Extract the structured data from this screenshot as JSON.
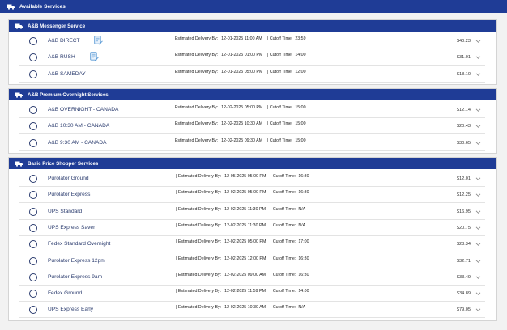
{
  "page": {
    "title": "Available Services",
    "title_icon": "truck-icon"
  },
  "groups": [
    {
      "title": "A&B Messenger Service",
      "icon": "truck-icon",
      "services": [
        {
          "name": "A&B DIRECT",
          "has_note": true,
          "note_icon": "note-edit-icon",
          "delivery_label": "| Estimated Delivery By:",
          "delivery": "12-01-2025 11:00 AM",
          "cutoff_label": "| Cutoff Time:",
          "cutoff": "23:59",
          "price": "$40.23"
        },
        {
          "name": "A&B RUSH",
          "has_note": true,
          "note_icon": "note-edit-icon",
          "delivery_label": "| Estimated Delivery By:",
          "delivery": "12-01-2025 01:00 PM",
          "cutoff_label": "| Cutoff Time:",
          "cutoff": "14:00",
          "price": "$31.01"
        },
        {
          "name": "A&B SAMEDAY",
          "has_note": false,
          "delivery_label": "| Estimated Delivery By:",
          "delivery": "12-01-2025 05:00 PM",
          "cutoff_label": "| Cutoff Time:",
          "cutoff": "12:00",
          "price": "$18.10"
        }
      ]
    },
    {
      "title": "A&B Premium Overnight Services",
      "icon": "truck-icon",
      "services": [
        {
          "name": "A&B OVERNIGHT - CANADA",
          "has_note": false,
          "delivery_label": "| Estimated Delivery By:",
          "delivery": "12-02-2025 05:00 PM",
          "cutoff_label": "| Cutoff Time:",
          "cutoff": "15:00",
          "price": "$12.14"
        },
        {
          "name": "A&B 10:30 AM - CANADA",
          "has_note": false,
          "delivery_label": "| Estimated Delivery By:",
          "delivery": "12-02-2025 10:30 AM",
          "cutoff_label": "| Cutoff Time:",
          "cutoff": "15:00",
          "price": "$20.43"
        },
        {
          "name": "A&B 9:30 AM - CANADA",
          "has_note": false,
          "delivery_label": "| Estimated Delivery By:",
          "delivery": "12-02-2025 09:30 AM",
          "cutoff_label": "| Cutoff Time:",
          "cutoff": "15:00",
          "price": "$30.65"
        }
      ]
    },
    {
      "title": "Basic Price Shopper Services",
      "icon": "truck-icon",
      "services": [
        {
          "name": "Purolator Ground",
          "has_note": false,
          "delivery_label": "| Estimated Delivery By:",
          "delivery": "12-05-2025 05:00 PM",
          "cutoff_label": "| Cutoff Time:",
          "cutoff": "16:30",
          "price": "$12.01"
        },
        {
          "name": "Purolator Express",
          "has_note": false,
          "delivery_label": "| Estimated Delivery By:",
          "delivery": "12-02-2025 05:00 PM",
          "cutoff_label": "| Cutoff Time:",
          "cutoff": "16:30",
          "price": "$12.25"
        },
        {
          "name": "UPS Standard",
          "has_note": false,
          "delivery_label": "| Estimated Delivery By:",
          "delivery": "12-02-2025 11:30 PM",
          "cutoff_label": "| Cutoff Time:",
          "cutoff": "N/A",
          "price": "$16.95"
        },
        {
          "name": "UPS Express Saver",
          "has_note": false,
          "delivery_label": "| Estimated Delivery By:",
          "delivery": "12-02-2025 11:30 PM",
          "cutoff_label": "| Cutoff Time:",
          "cutoff": "N/A",
          "price": "$20.75"
        },
        {
          "name": "Fedex Standard Overnight",
          "has_note": false,
          "delivery_label": "| Estimated Delivery By:",
          "delivery": "12-02-2025 05:00 PM",
          "cutoff_label": "| Cutoff Time:",
          "cutoff": "17:00",
          "price": "$28.34"
        },
        {
          "name": "Purolator Express 12pm",
          "has_note": false,
          "delivery_label": "| Estimated Delivery By:",
          "delivery": "12-02-2025 12:00 PM",
          "cutoff_label": "| Cutoff Time:",
          "cutoff": "16:30",
          "price": "$32.71"
        },
        {
          "name": "Purolator Express 9am",
          "has_note": false,
          "delivery_label": "| Estimated Delivery By:",
          "delivery": "12-02-2025 09:00 AM",
          "cutoff_label": "| Cutoff Time:",
          "cutoff": "16:30",
          "price": "$33.49"
        },
        {
          "name": "Fedex Ground",
          "has_note": false,
          "delivery_label": "| Estimated Delivery By:",
          "delivery": "12-02-2025 11:59 PM",
          "cutoff_label": "| Cutoff Time:",
          "cutoff": "14:00",
          "price": "$34.89"
        },
        {
          "name": "UPS Express Early",
          "has_note": false,
          "delivery_label": "| Estimated Delivery By:",
          "delivery": "12-02-2025 10:30 AM",
          "cutoff_label": "| Cutoff Time:",
          "cutoff": "N/A",
          "price": "$79.05"
        }
      ]
    }
  ],
  "colors": {
    "header_bg": "#1f3c96",
    "header_text": "#ffffff",
    "service_name": "#2a3b6e",
    "note_icon": "#5b9bd5"
  },
  "row_expand_icon": "chevron-down-icon"
}
